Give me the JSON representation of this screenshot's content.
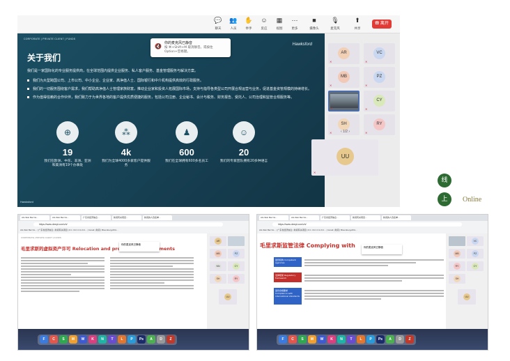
{
  "toolbar": {
    "items": [
      {
        "icon": "chat-icon",
        "label": "聊天"
      },
      {
        "icon": "people-icon",
        "label": "人员"
      },
      {
        "icon": "hand-icon",
        "label": "举手"
      },
      {
        "icon": "emoji-icon",
        "label": "反应"
      },
      {
        "icon": "view-icon",
        "label": "视图"
      },
      {
        "icon": "more-icon",
        "label": "更多"
      },
      {
        "icon": "camera-icon",
        "label": "摄像头"
      },
      {
        "icon": "mic-icon",
        "label": "麦克风"
      },
      {
        "icon": "share-icon",
        "label": "共享"
      }
    ],
    "leave_label": "离开"
  },
  "toast": {
    "title": "你的麦克风已静音",
    "body": "按 ⌘+Shift+M 取消静音。或按住 Option+空格键。"
  },
  "slide": {
    "header": "CORPORATE  |  PRIVATE CLIENT  |  FUNDS",
    "brand": "Hawksford",
    "title": "关于我们",
    "intro": "我们是一家国际化的专业服务提供商，在全球范围内提供企业服务、私人客户服务、基金管理服务与解决方案。",
    "bullets": [
      "我们为大型跨国公司、上市公司、中小企业、企业家、高净值人士、国际银行和中介机构提供高效的行政服务。",
      "我们的一切服务围绕客户需求，我们帮助高净值人士管理家族财富，推动企业家和投资人拓展国际市场，支持与指导各类型公司开展合规运营与业务，促进基金资管规模的持续增长。",
      "作为值得信赖的合作伙伴，我们致力于为世界各地的客户提供优质便捷的服务，包括公司注册、企业秘书、会计与税务、财务报告、受托人、公司治理和监管合规服务等。"
    ],
    "stats": [
      {
        "icon": "globe-icon",
        "value": "19",
        "caption": "我们在欧洲、中东、非洲、亚洲和美洲有19个办事处"
      },
      {
        "icon": "clients-icon",
        "value": "4k",
        "caption": "我们为全球4000多家客户提供服务"
      },
      {
        "icon": "team-icon",
        "value": "600",
        "caption": "我们在全球拥有600多名员工"
      },
      {
        "icon": "expert-icon",
        "value": "20",
        "caption": "我们的专家团队拥有20多种语言"
      }
    ],
    "footer": "Hawksford"
  },
  "participants": [
    {
      "initials": "AR",
      "color": "#f2d0b6"
    },
    {
      "initials": "VC",
      "color": "#c9d7f0"
    },
    {
      "initials": "MB",
      "color": "#f2c9b6"
    },
    {
      "initials": "PZ",
      "color": "#c9d7f0"
    },
    {
      "initials": "CY",
      "color": "#d9e9b9"
    },
    {
      "initials": "SH",
      "color": "#f2d6b8"
    },
    {
      "initials": "RY",
      "color": "#f5c6c6"
    }
  ],
  "pager": "1/2",
  "big_participant": {
    "initials": "UU",
    "color": "#e7c98e"
  },
  "legend": {
    "char1": "线",
    "char2": "上",
    "online_label": "Online"
  },
  "win_left": {
    "tabs": [
      "AG-Skin Bar No...",
      "AG-Skin Bar No...",
      "广东省经济信息...",
      "新闻有关项目...",
      "新闻的人员名单..."
    ],
    "url": "https://www.deepl.com/zh/",
    "bookmarks": "AG-Skin Bar No... | 广东省经济信息 | 新闻有关项目 | F.C. 04 C.3 & F.C... | Gmail | 新闻 | Bloomberg-Mini...",
    "doc_header": "CORPORATE | PRIVATE CLIENT | FUNDS",
    "title": "毛里求斯的虚拟资产许可 Relocation and provision of instruments",
    "toast_title": "你的麦克风已静音",
    "participants": [
      "AR",
      "MB",
      "NN",
      "SH",
      "PZ",
      "CY",
      "RY",
      "UU"
    ]
  },
  "win_right": {
    "tabs": [
      "AG-Skin Bar No...",
      "AG-Skin Bar No...",
      "广东省经济信息...",
      "新闻有关项目...",
      "新闻的人员名单..."
    ],
    "url": "https://www.deepl.com/zh/",
    "bookmarks": "AG-Skin Bar No... | 广东省经济信息 | 新闻有关项目 | F.C. 04 C.3 & F.C... | Gmail | 新闻 | Bloomberg-Mini...",
    "title_zh": "毛里求斯监管法律",
    "title_en": "Complying with",
    "rows": [
      {
        "label": "监管机构 Competent agencies",
        "color": "blue"
      },
      {
        "label": "法律框架 Regulatory framework",
        "color": "red"
      },
      {
        "label": "监管合规要求 Compliance with international standards",
        "color": "blue"
      }
    ],
    "toast_title": "你的麦克风已静音",
    "participants": [
      "VC",
      "MB",
      "RY",
      "PZ",
      "CY",
      "SH",
      "UU"
    ]
  },
  "dock_icons": [
    "F",
    "C",
    "S",
    "M",
    "W",
    "K",
    "N",
    "T",
    "L",
    "P",
    "Ps",
    "A",
    "D",
    "Z"
  ]
}
